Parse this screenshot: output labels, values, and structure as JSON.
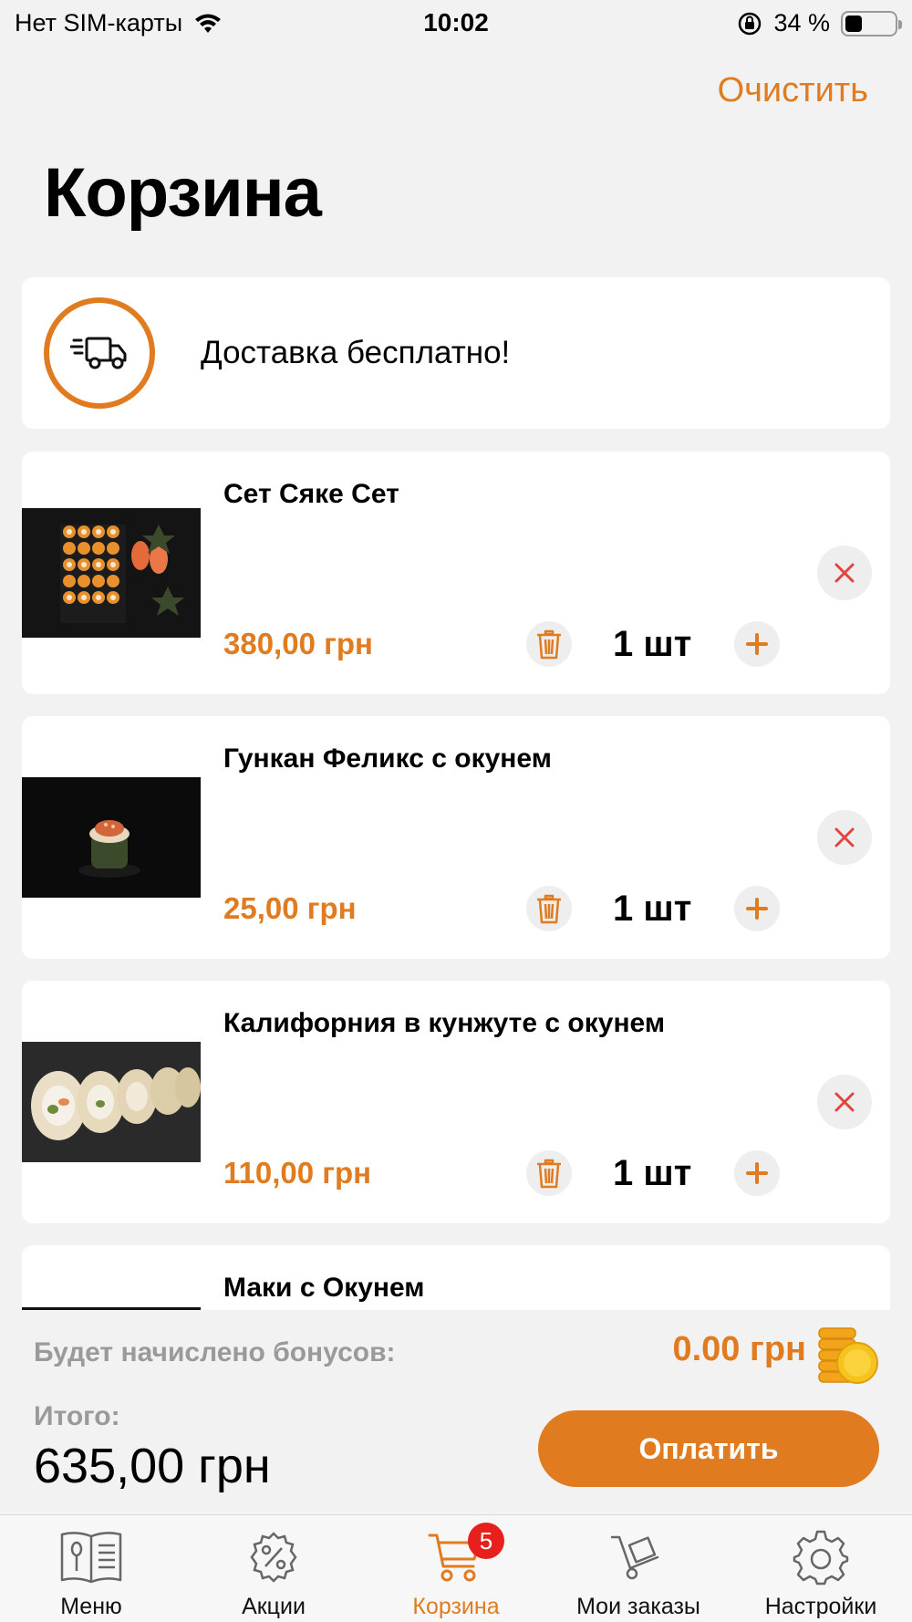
{
  "status_bar": {
    "carrier": "Нет SIM-карты",
    "time": "10:02",
    "battery": "34 %",
    "battery_level": 0.34
  },
  "header": {
    "clear_label": "Очистить",
    "title": "Корзина"
  },
  "delivery": {
    "text": "Доставка бесплатно!"
  },
  "items": [
    {
      "name": "Сет Сяке Сет",
      "price": "380,00 грн",
      "qty": "1 шт",
      "image": "sushi-set-photo"
    },
    {
      "name": "Гункан Феликс с окунем",
      "price": "25,00 грн",
      "qty": "1 шт",
      "image": "gunkan-photo"
    },
    {
      "name": "Калифорния в кунжуте с окунем",
      "price": "110,00 грн",
      "qty": "1 шт",
      "image": "california-roll-photo"
    },
    {
      "name": "Маки с Окунем",
      "price": "",
      "qty": "",
      "image": "maki-photo"
    }
  ],
  "footer": {
    "bonus_label": "Будет начислено бонусов:",
    "bonus_value": "0.00 грн",
    "total_label": "Итого:",
    "total_value": "635,00 грн",
    "pay_label": "Оплатить"
  },
  "tabs": [
    {
      "label": "Меню",
      "icon": "menu-book-icon"
    },
    {
      "label": "Акции",
      "icon": "percent-gear-icon"
    },
    {
      "label": "Корзина",
      "icon": "cart-icon",
      "badge": "5",
      "active": true
    },
    {
      "label": "Мои заказы",
      "icon": "hand-truck-icon"
    },
    {
      "label": "Настройки",
      "icon": "gear-icon"
    }
  ],
  "colors": {
    "accent": "#e07b20",
    "badge": "#e8201d",
    "remove": "#e0463f"
  }
}
